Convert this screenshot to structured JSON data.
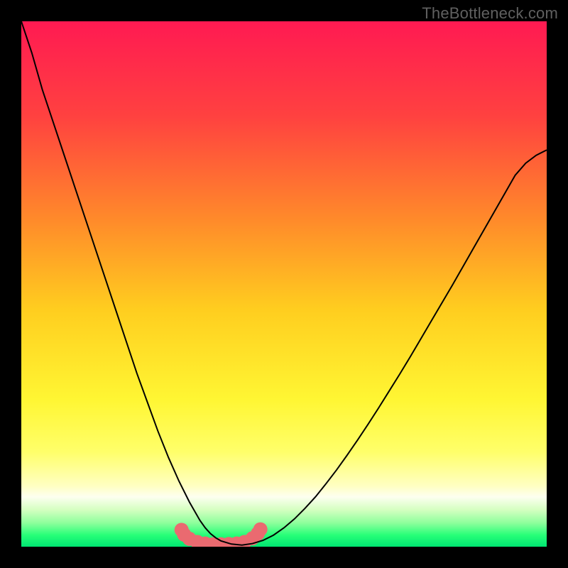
{
  "watermark": "TheBottleneck.com",
  "chart_data": {
    "type": "line",
    "title": "",
    "xlabel": "",
    "ylabel": "",
    "xlim": [
      0,
      100
    ],
    "ylim": [
      0,
      100
    ],
    "grid": false,
    "legend": false,
    "x": [
      0,
      2,
      4,
      6,
      8,
      10,
      12,
      14,
      16,
      18,
      20,
      22,
      24,
      26,
      28,
      30,
      32,
      34,
      35,
      36,
      37,
      38,
      40,
      42,
      44,
      46,
      48,
      50,
      52,
      54,
      56,
      58,
      60,
      62,
      64,
      66,
      68,
      70,
      72,
      74,
      76,
      78,
      80,
      82,
      84,
      86,
      88,
      90,
      92,
      94,
      96,
      98,
      100
    ],
    "values": [
      100,
      94,
      87,
      81,
      75,
      69,
      63,
      57,
      51,
      45,
      39,
      33,
      27.5,
      22,
      17,
      12.5,
      8.5,
      5,
      3.6,
      2.5,
      1.7,
      1.1,
      0.5,
      0.3,
      0.6,
      1.2,
      2.2,
      3.6,
      5.3,
      7.3,
      9.5,
      12,
      14.6,
      17.4,
      20.3,
      23.3,
      26.4,
      29.6,
      32.8,
      36.1,
      39.5,
      42.9,
      46.3,
      49.7,
      53.2,
      56.7,
      60.2,
      63.7,
      67.2,
      70.7,
      73,
      74.5,
      75.5
    ],
    "markers": {
      "x": [
        30.5,
        31,
        32,
        33.5,
        35,
        36.5,
        38,
        39.5,
        41,
        42.5,
        44,
        45,
        45.5
      ],
      "y": [
        3.2,
        2.3,
        1.5,
        0.9,
        0.6,
        0.45,
        0.45,
        0.5,
        0.6,
        0.9,
        1.6,
        2.5,
        3.3
      ],
      "color": "#ea6a70",
      "size": 10
    },
    "gradient_stops": [
      {
        "offset": 0.0,
        "color": "#ff1a52"
      },
      {
        "offset": 0.18,
        "color": "#ff4140"
      },
      {
        "offset": 0.38,
        "color": "#ff8b2a"
      },
      {
        "offset": 0.55,
        "color": "#ffce1f"
      },
      {
        "offset": 0.72,
        "color": "#fff633"
      },
      {
        "offset": 0.82,
        "color": "#ffff6a"
      },
      {
        "offset": 0.885,
        "color": "#ffffc3"
      },
      {
        "offset": 0.905,
        "color": "#fdfff0"
      },
      {
        "offset": 0.93,
        "color": "#d4ffc0"
      },
      {
        "offset": 0.955,
        "color": "#8dff9c"
      },
      {
        "offset": 0.978,
        "color": "#27ff78"
      },
      {
        "offset": 1.0,
        "color": "#00e672"
      }
    ]
  }
}
